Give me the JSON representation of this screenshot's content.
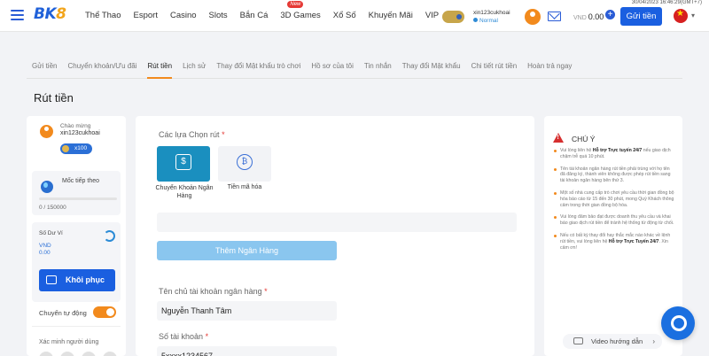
{
  "header": {
    "logo_main": "BK",
    "logo_accent": "8",
    "nav": [
      "Thể Thao",
      "Esport",
      "Casino",
      "Slots",
      "Bắn Cá",
      "3D Games",
      "Xổ Số",
      "Khuyến Mãi",
      "VIP"
    ],
    "new_badge": "New",
    "datetime": "30/04/2023 16:46:29(GMT+7)",
    "username": "xin123cukhoai",
    "user_level": "Normal",
    "currency": "VND",
    "balance": "0.00",
    "deposit_label": "Gửi tiền"
  },
  "tabs": [
    "Gửi tiền",
    "Chuyển khoản/Ưu đãi",
    "Rút tiền",
    "Lịch sử",
    "Thay đổi Mật khẩu trò chơi",
    "Hồ sơ của tôi",
    "Tin nhắn",
    "Thay đổi Mật khẩu",
    "Chi tiết rút tiền",
    "Hoàn trả ngay"
  ],
  "active_tab": "Rút tiền",
  "page_title": "Rút tiền",
  "sidebar": {
    "welcome": "Chào mừng",
    "username": "xin123cukhoai",
    "coins": "x100",
    "milestone_label": "Mốc tiếp theo",
    "milestone_value": "0 / 150000",
    "balance_label": "Số Dư Ví",
    "balance_currency": "VND",
    "balance_amount": "0.00",
    "restore_label": "Khôi phục",
    "auto_transfer_label": "Chuyển tự động",
    "verify_label": "Xác minh người dùng"
  },
  "form": {
    "choice_label": "Các lựa Chọn rút",
    "required_mark": "*",
    "option_bank": "Chuyển Khoản Ngân Hàng",
    "option_bank_icon": "$",
    "option_crypto": "Tiền mã hóa",
    "option_crypto_icon": "₿",
    "add_bank_label": "Thêm Ngân Hàng",
    "holder_label": "Tên chủ tài khoản ngân hàng",
    "holder_value": "Nguyễn Thanh Tâm",
    "account_label": "Số tài khoản",
    "account_value": "5xxxx1234567"
  },
  "notice": {
    "title": "CHÚ Ý",
    "notes": [
      {
        "pre": "Vui lòng liên hệ ",
        "bold": "Hỗ trợ Trực tuyến 24/7",
        "post": " nếu giao dịch chậm trễ quá 10 phút."
      },
      {
        "pre": "Tên tài khoản ngân hàng rút tiền phải trùng với họ tên đã đăng ký, thành viên không được phép rút tiền sang tài khoản ngân hàng bên thứ 3.",
        "bold": "",
        "post": ""
      },
      {
        "pre": "Một số nhà cung cấp trò chơi yêu cầu thời gian đồng bộ hóa báo cáo từ 15 đến 30 phút, mong Quý Khách thông cảm trong thời gian đồng bộ hóa.",
        "bold": "",
        "post": ""
      },
      {
        "pre": "Vui lòng đảm bảo đạt được doanh thu yêu cầu và khai báo giao dịch rút tiền để tránh hệ thống từ động từ chối.",
        "bold": "",
        "post": ""
      },
      {
        "pre": "Nếu có bất kỳ thay đổi hay thắc mắc nào khác về lệnh rút tiền, vui lòng liên hệ ",
        "bold": "Hỗ trợ Trực Tuyến 24/7",
        "post": ". Xin cảm ơn!"
      }
    ],
    "video_label": "Video hướng dẫn"
  },
  "colors": {
    "brand_blue": "#1a5fe0",
    "accent_orange": "#f28a1d",
    "selected_option": "#1a8fbf"
  }
}
